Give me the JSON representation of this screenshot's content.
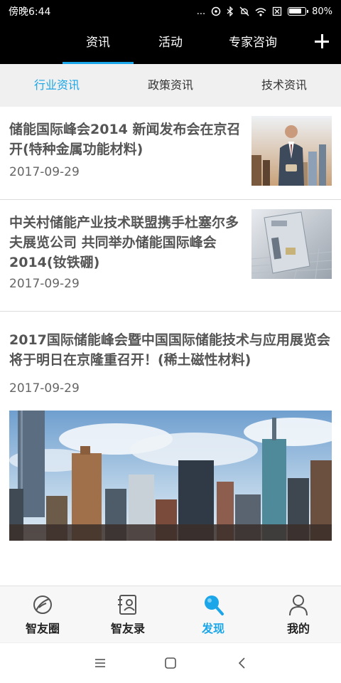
{
  "status_bar": {
    "time": "傍晚6:44",
    "dots": "...",
    "battery_text": "80%",
    "battery_level": 0.8
  },
  "top_nav": {
    "tabs": [
      {
        "label": "资讯",
        "active": true
      },
      {
        "label": "活动",
        "active": false
      },
      {
        "label": "专家咨询",
        "active": false
      }
    ],
    "add_icon": "plus-icon"
  },
  "sub_tabs": [
    {
      "label": "行业资讯",
      "active": true
    },
    {
      "label": "政策资讯",
      "active": false
    },
    {
      "label": "技术资讯",
      "active": false
    }
  ],
  "news": [
    {
      "title": "储能国际峰会2014 新闻发布会在京召开(特种金属功能材料)",
      "date": "2017-09-29",
      "image": "businessman-city-thumbnail"
    },
    {
      "title": "中关村储能产业技术联盟携手杜塞尔多夫展览公司 共同举办储能国际峰会2014(钕铁硼)",
      "date": "2017-09-29",
      "image": "credit-card-thumbnail"
    },
    {
      "title": "2017国际储能峰会暨中国国际储能技术与应用展览会将于明日在京隆重召开！(稀土磁性材料)",
      "date": "2017-09-29",
      "image": "city-skyline-banner"
    }
  ],
  "bottom_nav": [
    {
      "label": "智友圈",
      "icon": "friend-circle-icon",
      "active": false
    },
    {
      "label": "智友录",
      "icon": "contacts-icon",
      "active": false
    },
    {
      "label": "发现",
      "icon": "search-icon",
      "active": true
    },
    {
      "label": "我的",
      "icon": "person-icon",
      "active": false
    }
  ],
  "colors": {
    "accent": "#1aa6e8",
    "header_bg": "#000000",
    "subtab_bg": "#f0f0f0"
  }
}
